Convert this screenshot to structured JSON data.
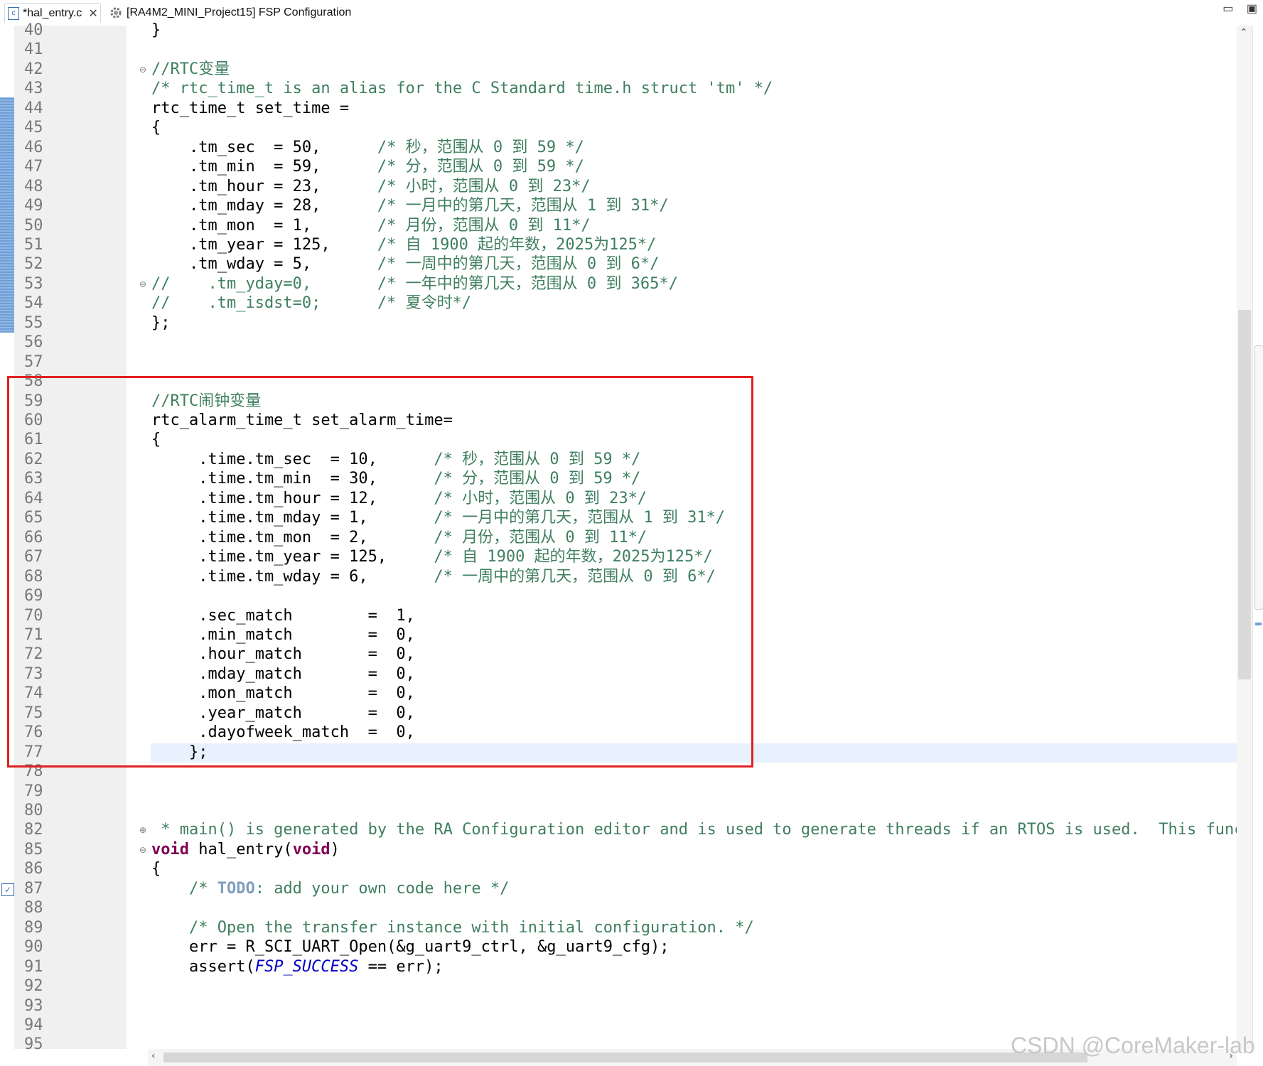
{
  "tabs": [
    {
      "label": "*hal_entry.c",
      "icon": "c-file-icon",
      "close": "✕"
    },
    {
      "label": "[RA4M2_MINI_Project15] FSP Configuration",
      "icon": "gear-icon"
    }
  ],
  "window_controls": {
    "minimize": "▭",
    "maximize": "▣"
  },
  "scroll_arrows": {
    "up": "⌃",
    "left": "‹",
    "right": "›"
  },
  "watermark": "CSDN @CoreMaker-lab",
  "fold_markers": {
    "collapse": "⊖",
    "expand": "⊕"
  },
  "lines": [
    {
      "n": "40",
      "segs": [
        {
          "t": "}",
          "c": "pl"
        }
      ]
    },
    {
      "n": "41",
      "segs": []
    },
    {
      "n": "42",
      "fold": "collapse",
      "segs": [
        {
          "t": "//RTC变量",
          "c": "cm"
        }
      ]
    },
    {
      "n": "43",
      "segs": [
        {
          "t": "/* rtc_time_t is an alias for the C Standard time.h struct 'tm' */",
          "c": "cm"
        }
      ]
    },
    {
      "n": "44",
      "segs": [
        {
          "t": "rtc_time_t set_time =",
          "c": "pl"
        }
      ]
    },
    {
      "n": "45",
      "segs": [
        {
          "t": "{",
          "c": "pl"
        }
      ]
    },
    {
      "n": "46",
      "segs": [
        {
          "t": "    .tm_sec  = 50,      ",
          "c": "pl"
        },
        {
          "t": "/* 秒，范围从 0 到 59 */",
          "c": "cm"
        }
      ]
    },
    {
      "n": "47",
      "segs": [
        {
          "t": "    .tm_min  = 59,      ",
          "c": "pl"
        },
        {
          "t": "/* 分，范围从 0 到 59 */",
          "c": "cm"
        }
      ]
    },
    {
      "n": "48",
      "segs": [
        {
          "t": "    .tm_hour = 23,      ",
          "c": "pl"
        },
        {
          "t": "/* 小时，范围从 0 到 23*/",
          "c": "cm"
        }
      ]
    },
    {
      "n": "49",
      "segs": [
        {
          "t": "    .tm_mday = 28,      ",
          "c": "pl"
        },
        {
          "t": "/* 一月中的第几天，范围从 1 到 31*/",
          "c": "cm"
        }
      ]
    },
    {
      "n": "50",
      "segs": [
        {
          "t": "    .tm_mon  = 1,       ",
          "c": "pl"
        },
        {
          "t": "/* 月份，范围从 0 到 11*/",
          "c": "cm"
        }
      ]
    },
    {
      "n": "51",
      "segs": [
        {
          "t": "    .tm_year = 125,     ",
          "c": "pl"
        },
        {
          "t": "/* 自 1900 起的年数，2025为125*/",
          "c": "cm"
        }
      ]
    },
    {
      "n": "52",
      "segs": [
        {
          "t": "    .tm_wday = 5,       ",
          "c": "pl"
        },
        {
          "t": "/* 一周中的第几天，范围从 0 到 6*/",
          "c": "cm"
        }
      ]
    },
    {
      "n": "53",
      "fold": "collapse",
      "segs": [
        {
          "t": "//    .tm_yday=0,       /* 一年中的第几天，范围从 0 到 365*/",
          "c": "cm"
        }
      ]
    },
    {
      "n": "54",
      "segs": [
        {
          "t": "//    .tm_isdst=0;      /* 夏令时*/",
          "c": "cm"
        }
      ]
    },
    {
      "n": "55",
      "segs": [
        {
          "t": "};",
          "c": "pl"
        }
      ]
    },
    {
      "n": "56",
      "segs": []
    },
    {
      "n": "57",
      "segs": []
    },
    {
      "n": "58",
      "segs": []
    },
    {
      "n": "59",
      "segs": [
        {
          "t": "//RTC闹钟变量",
          "c": "cm"
        }
      ]
    },
    {
      "n": "60",
      "segs": [
        {
          "t": "rtc_alarm_time_t set_alarm_time=",
          "c": "pl"
        }
      ]
    },
    {
      "n": "61",
      "segs": [
        {
          "t": "{",
          "c": "pl"
        }
      ]
    },
    {
      "n": "62",
      "segs": [
        {
          "t": "     .time.tm_sec  = 10,      ",
          "c": "pl"
        },
        {
          "t": "/* 秒，范围从 0 到 59 */",
          "c": "cm"
        }
      ]
    },
    {
      "n": "63",
      "segs": [
        {
          "t": "     .time.tm_min  = 30,      ",
          "c": "pl"
        },
        {
          "t": "/* 分，范围从 0 到 59 */",
          "c": "cm"
        }
      ]
    },
    {
      "n": "64",
      "segs": [
        {
          "t": "     .time.tm_hour = 12,      ",
          "c": "pl"
        },
        {
          "t": "/* 小时，范围从 0 到 23*/",
          "c": "cm"
        }
      ]
    },
    {
      "n": "65",
      "segs": [
        {
          "t": "     .time.tm_mday = 1,       ",
          "c": "pl"
        },
        {
          "t": "/* 一月中的第几天，范围从 1 到 31*/",
          "c": "cm"
        }
      ]
    },
    {
      "n": "66",
      "segs": [
        {
          "t": "     .time.tm_mon  = 2,       ",
          "c": "pl"
        },
        {
          "t": "/* 月份，范围从 0 到 11*/",
          "c": "cm"
        }
      ]
    },
    {
      "n": "67",
      "segs": [
        {
          "t": "     .time.tm_year = 125,     ",
          "c": "pl"
        },
        {
          "t": "/* 自 1900 起的年数，2025为125*/",
          "c": "cm"
        }
      ]
    },
    {
      "n": "68",
      "segs": [
        {
          "t": "     .time.tm_wday = 6,       ",
          "c": "pl"
        },
        {
          "t": "/* 一周中的第几天，范围从 0 到 6*/",
          "c": "cm"
        }
      ]
    },
    {
      "n": "69",
      "segs": []
    },
    {
      "n": "70",
      "segs": [
        {
          "t": "     .sec_match        =  1,",
          "c": "pl"
        }
      ]
    },
    {
      "n": "71",
      "segs": [
        {
          "t": "     .min_match        =  0,",
          "c": "pl"
        }
      ]
    },
    {
      "n": "72",
      "segs": [
        {
          "t": "     .hour_match       =  0,",
          "c": "pl"
        }
      ]
    },
    {
      "n": "73",
      "segs": [
        {
          "t": "     .mday_match       =  0,",
          "c": "pl"
        }
      ]
    },
    {
      "n": "74",
      "segs": [
        {
          "t": "     .mon_match        =  0,",
          "c": "pl"
        }
      ]
    },
    {
      "n": "75",
      "segs": [
        {
          "t": "     .year_match       =  0,",
          "c": "pl"
        }
      ]
    },
    {
      "n": "76",
      "segs": [
        {
          "t": "     .dayofweek_match  =  0,",
          "c": "pl"
        }
      ]
    },
    {
      "n": "77",
      "segs": [
        {
          "t": "    };",
          "c": "pl"
        }
      ]
    },
    {
      "n": "78",
      "segs": []
    },
    {
      "n": "79",
      "segs": []
    },
    {
      "n": "80",
      "segs": []
    },
    {
      "n": "82",
      "fold": "expand",
      "segs": [
        {
          "t": " * main() is generated by the RA Configuration editor and is used to generate threads if an RTOS is used.  This funct:",
          "c": "cm"
        }
      ]
    },
    {
      "n": "85",
      "fold": "collapse",
      "segs": [
        {
          "t": "void",
          "c": "kw"
        },
        {
          "t": " hal_entry(",
          "c": "pl"
        },
        {
          "t": "void",
          "c": "kw"
        },
        {
          "t": ")",
          "c": "pl"
        }
      ]
    },
    {
      "n": "86",
      "segs": [
        {
          "t": "{",
          "c": "pl"
        }
      ]
    },
    {
      "n": "87",
      "task": true,
      "segs": [
        {
          "t": "    /* ",
          "c": "cm"
        },
        {
          "t": "TODO",
          "c": "todo"
        },
        {
          "t": ": add your own code here */",
          "c": "cm"
        }
      ]
    },
    {
      "n": "88",
      "segs": []
    },
    {
      "n": "89",
      "segs": [
        {
          "t": "    /* Open the transfer instance with initial configuration. */",
          "c": "cm"
        }
      ]
    },
    {
      "n": "90",
      "segs": [
        {
          "t": "    err = R_SCI_UART_Open(&g_uart9_ctrl, &g_uart9_cfg);",
          "c": "pl"
        }
      ]
    },
    {
      "n": "91",
      "segs": [
        {
          "t": "    assert(",
          "c": "pl"
        },
        {
          "t": "FSP_SUCCESS",
          "c": "mac"
        },
        {
          "t": " == err);",
          "c": "pl"
        }
      ]
    },
    {
      "n": "92",
      "segs": []
    },
    {
      "n": "93",
      "segs": []
    },
    {
      "n": "94",
      "segs": []
    },
    {
      "n": "95",
      "segs": []
    }
  ]
}
